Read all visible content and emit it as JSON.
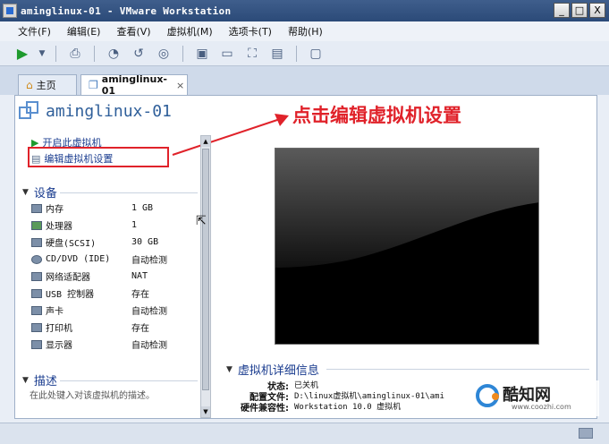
{
  "window": {
    "title": "aminglinux-01 - VMware Workstation",
    "buttons": [
      "_",
      "□",
      "X"
    ]
  },
  "menu": [
    "文件(F)",
    "编辑(E)",
    "查看(V)",
    "虚拟机(M)",
    "选项卡(T)",
    "帮助(H)"
  ],
  "toolbar": {
    "icons": [
      "play-icon",
      "dropdown-icon",
      "print-icon",
      "snapshot-icon",
      "revert-icon",
      "manage-snapshot-icon",
      "view-normal-icon",
      "view-unity-icon",
      "fullscreen-icon",
      "settings-icon",
      "console-icon"
    ]
  },
  "tabs": [
    {
      "label": "主页",
      "icon": "home-icon"
    },
    {
      "label": "aminglinux-01",
      "icon": "vm-icon",
      "close": "×"
    }
  ],
  "vm": {
    "name": "aminglinux-01",
    "annotation": "点击编辑虚拟机设置"
  },
  "actions": {
    "power_on": "开启此虚拟机",
    "edit_settings": "编辑虚拟机设置"
  },
  "devices": {
    "heading": "设备",
    "items": [
      {
        "name": "内存",
        "value": "1 GB"
      },
      {
        "name": "处理器",
        "value": "1"
      },
      {
        "name": "硬盘(SCSI)",
        "value": "30 GB"
      },
      {
        "name": "CD/DVD (IDE)",
        "value": "自动检测"
      },
      {
        "name": "网络适配器",
        "value": "NAT"
      },
      {
        "name": "USB 控制器",
        "value": "存在"
      },
      {
        "name": "声卡",
        "value": "自动检测"
      },
      {
        "name": "打印机",
        "value": "存在"
      },
      {
        "name": "显示器",
        "value": "自动检测"
      }
    ]
  },
  "description": {
    "heading": "描述",
    "placeholder": "在此处键入对该虚拟机的描述。"
  },
  "details": {
    "heading": "虚拟机详细信息",
    "rows": [
      {
        "label": "状态:",
        "value": "已关机"
      },
      {
        "label": "配置文件:",
        "value": "D:\\linux虚拟机\\aminglinux-01\\ami"
      },
      {
        "label": "硬件兼容性:",
        "value": "Workstation 10.0 虚拟机"
      }
    ]
  },
  "watermark": {
    "text": "酷知网",
    "url": "www.coozhi.com"
  },
  "colors": {
    "annotation": "#e0222a",
    "link": "#1a3c8f",
    "title_bar": "#2b4a78"
  }
}
